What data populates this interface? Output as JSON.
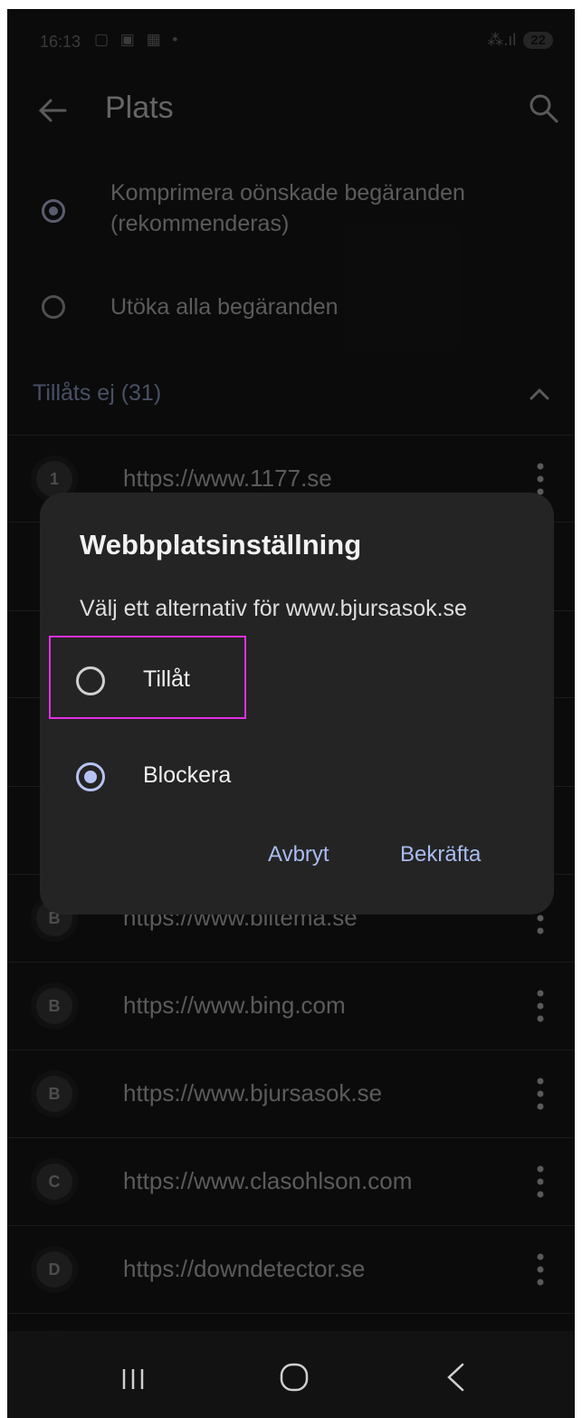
{
  "status_bar": {
    "time": "16:13",
    "battery": "22"
  },
  "app_bar": {
    "title": "Plats"
  },
  "options": [
    {
      "label": "Komprimera oönskade begäranden (rekommenderas)",
      "selected": true
    },
    {
      "label": "Utöka alla begäranden",
      "selected": false
    }
  ],
  "section": {
    "title": "Tillåts ej (31)"
  },
  "sites": [
    {
      "avatar": "1",
      "url": "https://www.1177.se"
    },
    {
      "avatar": "B",
      "url": "https://www.biltema.se"
    },
    {
      "avatar": "B",
      "url": "https://www.bing.com"
    },
    {
      "avatar": "B",
      "url": "https://www.bjursasok.se"
    },
    {
      "avatar": "C",
      "url": "https://www.clasohlson.com"
    },
    {
      "avatar": "D",
      "url": "https://downdetector.se"
    }
  ],
  "dialog": {
    "title": "Webbplatsinställning",
    "subtitle": "Välj ett alternativ för www.bjursasok.se",
    "options": [
      {
        "label": "Tillåt",
        "selected": false
      },
      {
        "label": "Blockera",
        "selected": true
      }
    ],
    "cancel": "Avbryt",
    "confirm": "Bekräfta"
  },
  "colors": {
    "accent": "#a9bcf0",
    "highlight": "#e52ee5",
    "background": "#121212",
    "dialog": "#242424"
  }
}
